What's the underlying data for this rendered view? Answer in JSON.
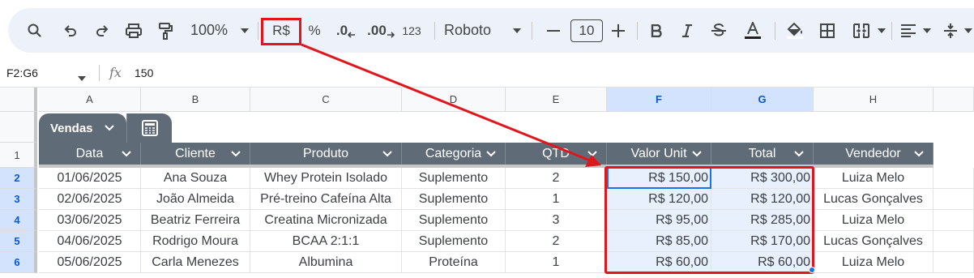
{
  "toolbar": {
    "zoom": "100%",
    "currency": "R$",
    "percent": "%",
    "dec_decrease": ".0",
    "dec_increase": ".00",
    "number_format": "123",
    "font": "Roboto",
    "font_size": "10"
  },
  "formula_bar": {
    "name_box": "F2:G6",
    "fx": "fx",
    "value": "150"
  },
  "columns": [
    "A",
    "B",
    "C",
    "D",
    "E",
    "F",
    "G",
    "H"
  ],
  "rows": [
    "1",
    "2",
    "3",
    "4",
    "5",
    "6"
  ],
  "table": {
    "tab_name": "Vendas",
    "headers": [
      "Data",
      "Cliente",
      "Produto",
      "Categoria",
      "QTD",
      "Valor Unit",
      "Total",
      "Vendedor"
    ],
    "data": [
      [
        "01/06/2025",
        "Ana Souza",
        "Whey Protein Isolado",
        "Suplemento",
        "2",
        "R$ 150,00",
        "R$ 300,00",
        "Luiza Melo"
      ],
      [
        "02/06/2025",
        "João Almeida",
        "Pré-treino Cafeína Alta",
        "Suplemento",
        "1",
        "R$ 120,00",
        "R$ 120,00",
        "Lucas Gonçalves"
      ],
      [
        "03/06/2025",
        "Beatriz Ferreira",
        "Creatina Micronizada",
        "Suplemento",
        "3",
        "R$ 95,00",
        "R$ 285,00",
        "Luiza Melo"
      ],
      [
        "04/06/2025",
        "Rodrigo Moura",
        "BCAA 2:1:1",
        "Suplemento",
        "2",
        "R$ 85,00",
        "R$ 170,00",
        "Lucas Gonçalves"
      ],
      [
        "05/06/2025",
        "Carla Menezes",
        "Albumina",
        "Proteína",
        "1",
        "R$ 60,00",
        "R$ 60,00",
        "Luiza Melo"
      ]
    ]
  },
  "colors": {
    "highlight": "#e0161d",
    "selection": "#1a73e8",
    "table_header": "#5f6b77"
  }
}
